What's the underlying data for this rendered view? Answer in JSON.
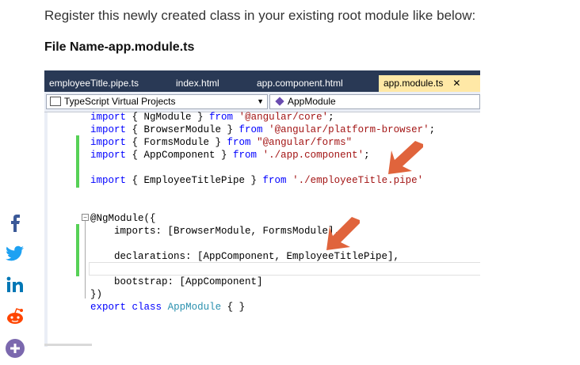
{
  "intro_text": "Register this newly created class in your existing root module like below:",
  "file_label": "File Name-app.module.ts",
  "tabs": [
    {
      "label": "employeeTitle.pipe.ts",
      "active": false
    },
    {
      "label": "index.html",
      "active": false
    },
    {
      "label": "app.component.html",
      "active": false
    },
    {
      "label": "app.module.ts",
      "active": true,
      "close": "✕"
    }
  ],
  "project_dropdown": "TypeScript Virtual Projects",
  "member_dropdown": "AppModule",
  "code": {
    "l1": [
      "import",
      " { NgModule } ",
      "from",
      " ",
      "'@angular/core'",
      ";"
    ],
    "l2": [
      "import",
      " { BrowserModule } ",
      "from",
      " ",
      "'@angular/platform-browser'",
      ";"
    ],
    "l3": [
      "import",
      " { FormsModule } ",
      "from",
      " ",
      "\"@angular/forms\""
    ],
    "l4": [
      "import",
      " { AppComponent } ",
      "from",
      " ",
      "'./app.component'",
      ";"
    ],
    "l5": [
      "import",
      " { EmployeeTitlePipe } ",
      "from",
      " ",
      "'./employeeTitle.pipe'"
    ],
    "l6": "@NgModule({",
    "l7": "    imports: [BrowserModule, FormsModule],",
    "l8": "    declarations: [AppComponent, EmployeeTitlePipe],",
    "l9": "    bootstrap: [AppComponent]",
    "l10": "})",
    "l11": [
      "export",
      " ",
      "class",
      " ",
      "AppModule",
      " { }"
    ]
  },
  "colors": {
    "tab_bar": "#293955",
    "active_tab": "#ffe8a6",
    "keyword": "#0000ff",
    "string": "#a31515",
    "type": "#2b91af",
    "change_bar": "#57d157",
    "arrow": "#e0643c",
    "facebook": "#3b5998",
    "twitter": "#1da1f2",
    "linkedin": "#0077b5",
    "reddit": "#ff4500",
    "more": "#7b68ae"
  },
  "social": [
    "facebook-icon",
    "twitter-icon",
    "linkedin-icon",
    "reddit-icon",
    "more-share-icon"
  ]
}
